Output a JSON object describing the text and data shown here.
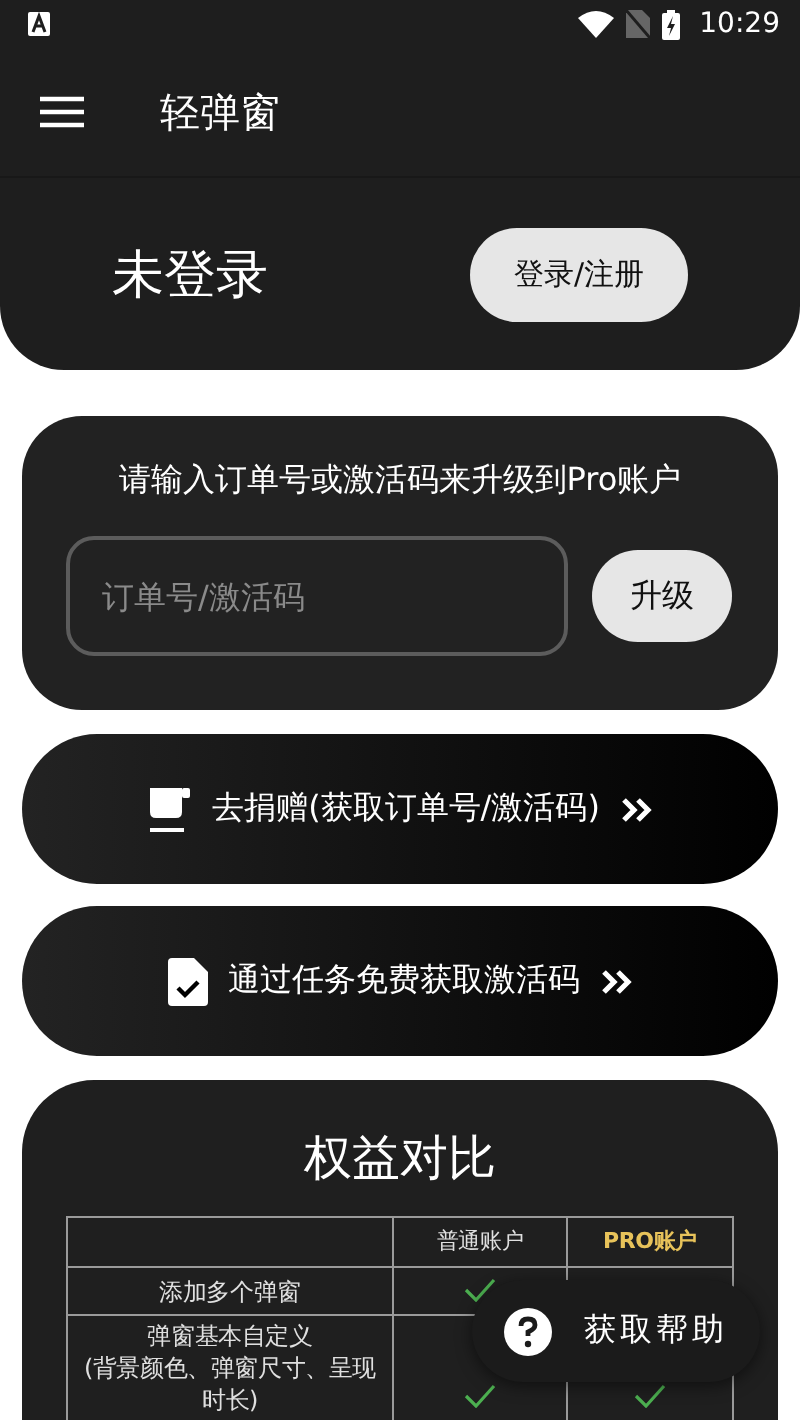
{
  "status_bar": {
    "time": "10:29"
  },
  "app_bar": {
    "title": "轻弹窗"
  },
  "account": {
    "status": "未登录",
    "login_button": "登录/注册"
  },
  "upgrade": {
    "prompt": "请输入订单号或激活码来升级到Pro账户",
    "field": {
      "placeholder": "订单号/激活码"
    },
    "button": "升级"
  },
  "actions": [
    {
      "kind": "donate",
      "label": "去捐赠(获取订单号/激活码)"
    },
    {
      "kind": "task",
      "label": "通过任务免费获取激活码"
    }
  ],
  "comparison": {
    "title": "权益对比",
    "columns": [
      "普通账户",
      "PRO账户"
    ],
    "rows": [
      {
        "feature": "添加多个弹窗",
        "normal": true
      },
      {
        "feature": "弹窗基本自定义\n(背景颜色、弹窗尺寸、呈现时长)",
        "normal": true,
        "pro": true
      }
    ]
  },
  "help_button": {
    "label": "获取帮助"
  }
}
